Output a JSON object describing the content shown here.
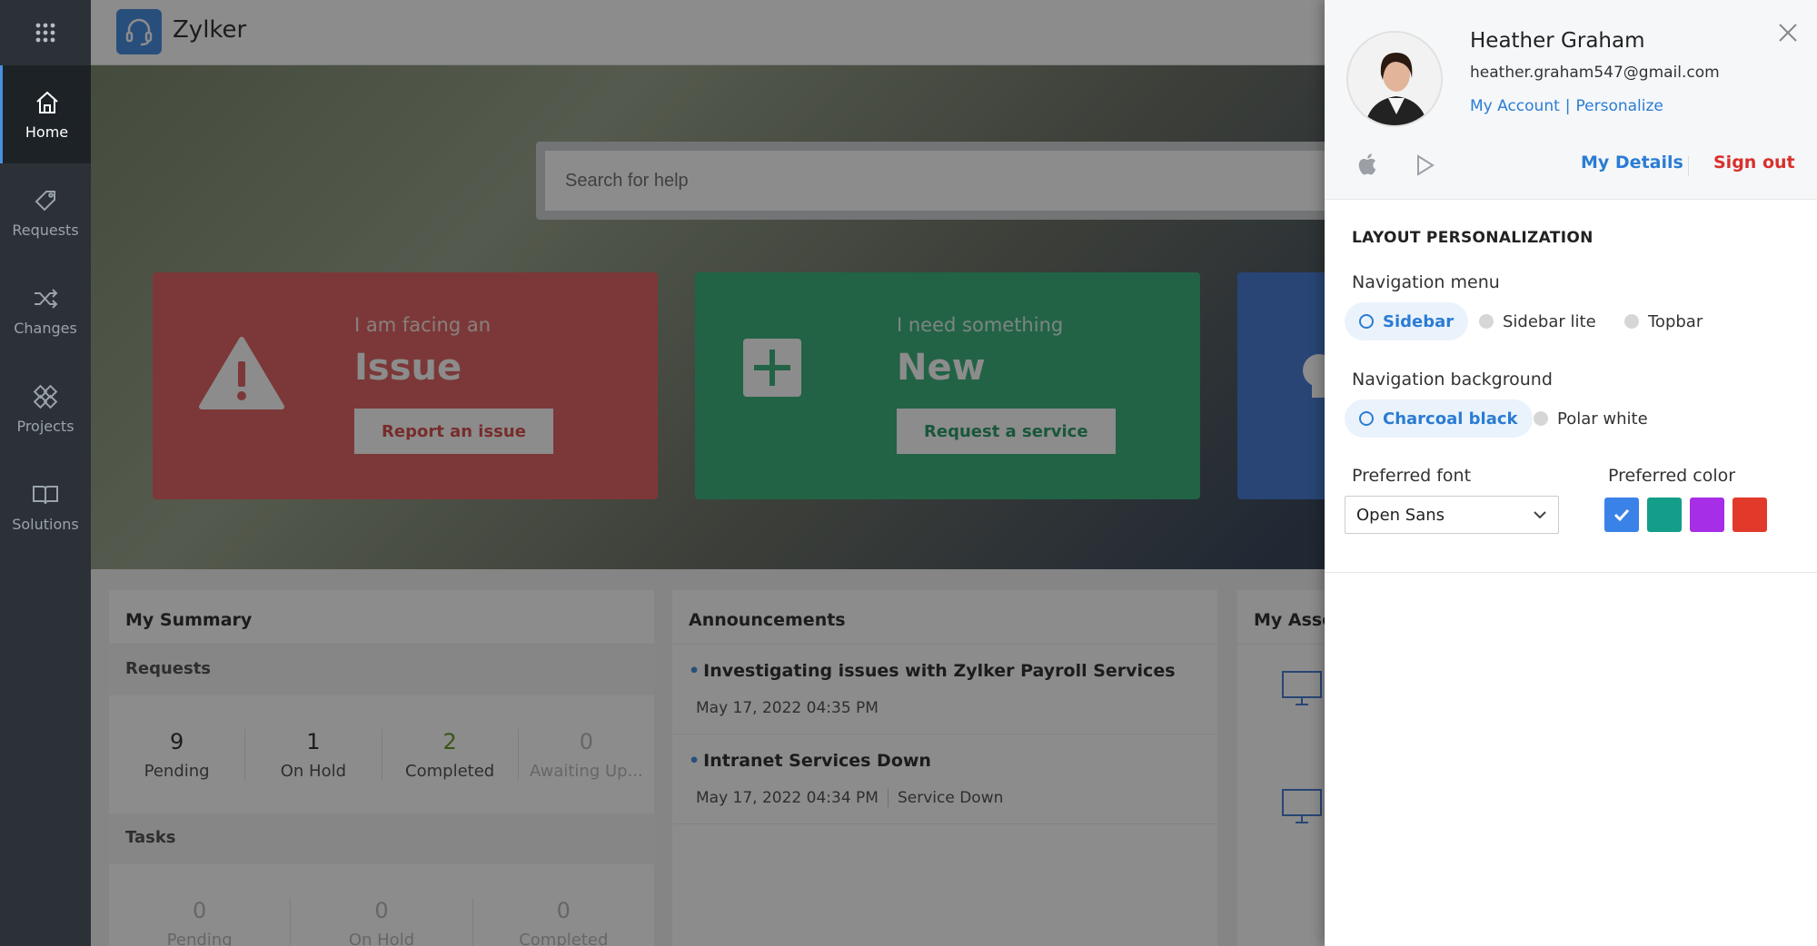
{
  "app": {
    "brand": "Zylker"
  },
  "rail": {
    "items": [
      {
        "label": "Home",
        "icon": "home-icon"
      },
      {
        "label": "Requests",
        "icon": "tag-icon"
      },
      {
        "label": "Changes",
        "icon": "shuffle-icon"
      },
      {
        "label": "Projects",
        "icon": "puzzle-icon"
      },
      {
        "label": "Solutions",
        "icon": "book-icon"
      }
    ]
  },
  "search": {
    "placeholder": "Search for help"
  },
  "cards": [
    {
      "small": "I am facing an",
      "big": "Issue",
      "button": "Report an issue",
      "color": "#e26666"
    },
    {
      "small": "I need something",
      "big": "New",
      "button": "Request a service",
      "color": "#3fb47f"
    }
  ],
  "summary": {
    "title": "My Summary",
    "requests_label": "Requests",
    "requests": [
      {
        "value": "9",
        "label": "Pending"
      },
      {
        "value": "1",
        "label": "On Hold"
      },
      {
        "value": "2",
        "label": "Completed"
      },
      {
        "value": "0",
        "label": "Awaiting Up..."
      }
    ],
    "tasks_label": "Tasks",
    "tasks": [
      {
        "value": "0",
        "label": "Pending"
      },
      {
        "value": "0",
        "label": "On Hold"
      },
      {
        "value": "0",
        "label": "Completed"
      }
    ]
  },
  "announcements": {
    "title": "Announcements",
    "items": [
      {
        "title": "Investigating issues with Zylker Payroll Services",
        "date": "May 17, 2022 04:35 PM",
        "tag": ""
      },
      {
        "title": "Intranet Services Down",
        "date": "May 17, 2022 04:34 PM",
        "tag": "Service Down"
      }
    ]
  },
  "assets": {
    "title": "My Asse"
  },
  "profile": {
    "name": "Heather Graham",
    "email": "heather.graham547@gmail.com",
    "my_account": "My Account",
    "personalize": "Personalize",
    "my_details": "My Details",
    "sign_out": "Sign out",
    "layout_title": "LAYOUT PERSONALIZATION",
    "nav_menu_label": "Navigation menu",
    "nav_menu_options": [
      "Sidebar",
      "Sidebar lite",
      "Topbar"
    ],
    "nav_menu_selected": "Sidebar",
    "nav_bg_label": "Navigation background",
    "nav_bg_options": [
      "Charcoal black",
      "Polar white"
    ],
    "nav_bg_selected": "Charcoal black",
    "font_label": "Preferred font",
    "font_value": "Open Sans",
    "color_label": "Preferred color",
    "colors": [
      "#3b82e8",
      "#139e8a",
      "#a52ee6",
      "#e23a2a"
    ],
    "selected_color": "#3b82e8"
  }
}
